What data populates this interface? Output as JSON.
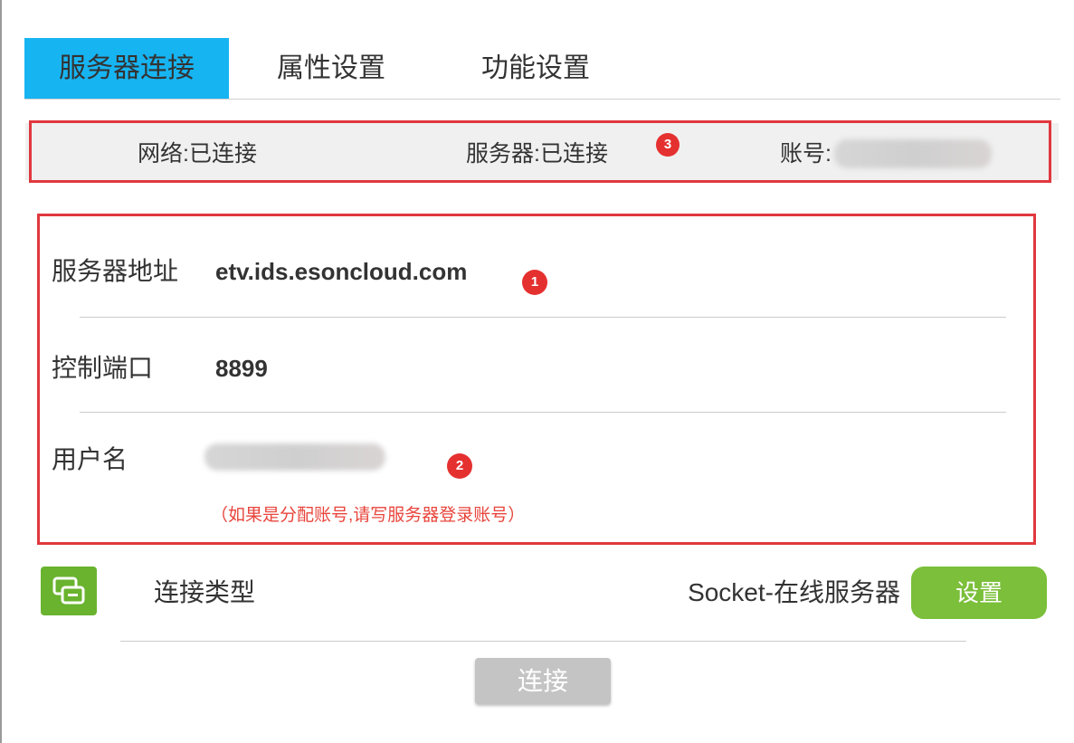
{
  "tabs": [
    {
      "label": "服务器连接",
      "active": true
    },
    {
      "label": "属性设置",
      "active": false
    },
    {
      "label": "功能设置",
      "active": false
    }
  ],
  "status": {
    "network": "网络:已连接",
    "server": "服务器:已连接",
    "account_label": "账号:"
  },
  "form": {
    "server_address": {
      "label": "服务器地址",
      "value": "etv.ids.esoncloud.com"
    },
    "control_port": {
      "label": "控制端口",
      "value": "8899"
    },
    "username": {
      "label": "用户名",
      "hint": "（如果是分配账号,请写服务器登录账号）"
    }
  },
  "connection_type": {
    "icon": "connection-switch-icon",
    "label": "连接类型",
    "value": "Socket-在线服务器",
    "settings_button": "设置"
  },
  "connect_button": "连接",
  "annotations": {
    "marker_1": "1",
    "marker_2": "2",
    "marker_3": "3"
  },
  "colors": {
    "active_tab": "#17b4f2",
    "annotation_red": "#e0383e",
    "hint_red": "#e8453c",
    "green": "#7bbf3a",
    "disabled_button": "#c4c4c4"
  }
}
